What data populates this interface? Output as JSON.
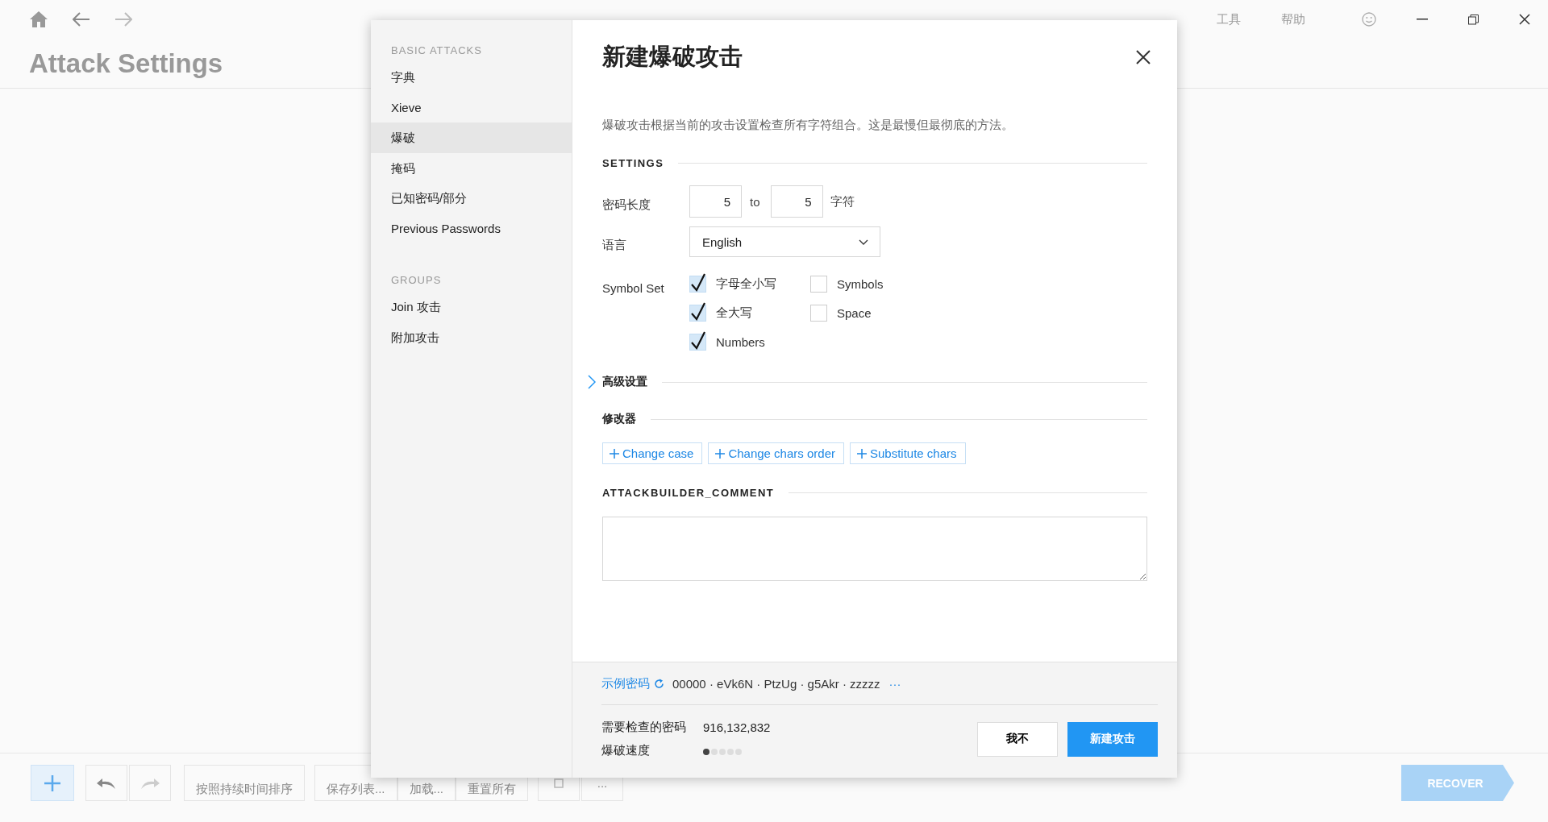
{
  "topbar": {
    "title": "Attack Settings",
    "menu": [
      "工具",
      "帮助"
    ]
  },
  "toolbar": {
    "buttons": [
      "按照持续时间排序",
      "保存列表...",
      "加载...",
      "重置所有"
    ],
    "more": "...",
    "recover": "RECOVER"
  },
  "dialog": {
    "title": "新建爆破攻击",
    "description": "爆破攻击根据当前的攻击设置检查所有字符组合。这是最慢但最彻底的方法。",
    "sidebar": [
      {
        "heading": "BASIC ATTACKS",
        "items": [
          {
            "label": "字典",
            "selected": false
          },
          {
            "label": "Xieve",
            "selected": false
          },
          {
            "label": "爆破",
            "selected": true
          },
          {
            "label": "掩码",
            "selected": false
          },
          {
            "label": "已知密码/部分",
            "selected": false
          },
          {
            "label": "Previous Passwords",
            "selected": false
          }
        ]
      },
      {
        "heading": "GROUPS",
        "items": [
          {
            "label": "Join 攻击",
            "selected": false
          },
          {
            "label": "附加攻击",
            "selected": false
          }
        ]
      }
    ],
    "settings": {
      "heading": "SETTINGS",
      "length_label": "密码长度",
      "min": "5",
      "to": "to",
      "max": "5",
      "unit": "字符",
      "language_label": "语言",
      "language": "English",
      "symbol_label": "Symbol Set",
      "symbols": [
        {
          "label": "字母全小写",
          "checked": true
        },
        {
          "label": "Symbols",
          "checked": false
        },
        {
          "label": "全大写",
          "checked": true
        },
        {
          "label": "Space",
          "checked": false
        },
        {
          "label": "Numbers",
          "checked": true
        }
      ]
    },
    "advanced": {
      "label": "高级设置",
      "expanded": false
    },
    "modifiers": {
      "heading": "修改器",
      "buttons": [
        "Change case",
        "Change chars order",
        "Substitute chars"
      ]
    },
    "comment": {
      "heading": "ATTACKBUILDER_COMMENT"
    },
    "footer": {
      "sample_label": "示例密码",
      "samples": "00000 · eVk6N · PtzUg · g5Akr · zzzzz",
      "more": "···",
      "count_label": "需要检查的密码",
      "count": "916,132,832",
      "speed_label": "爆破速度",
      "speed": {
        "level": 0.2
      },
      "cancel": "我不",
      "submit": "新建攻击"
    }
  }
}
